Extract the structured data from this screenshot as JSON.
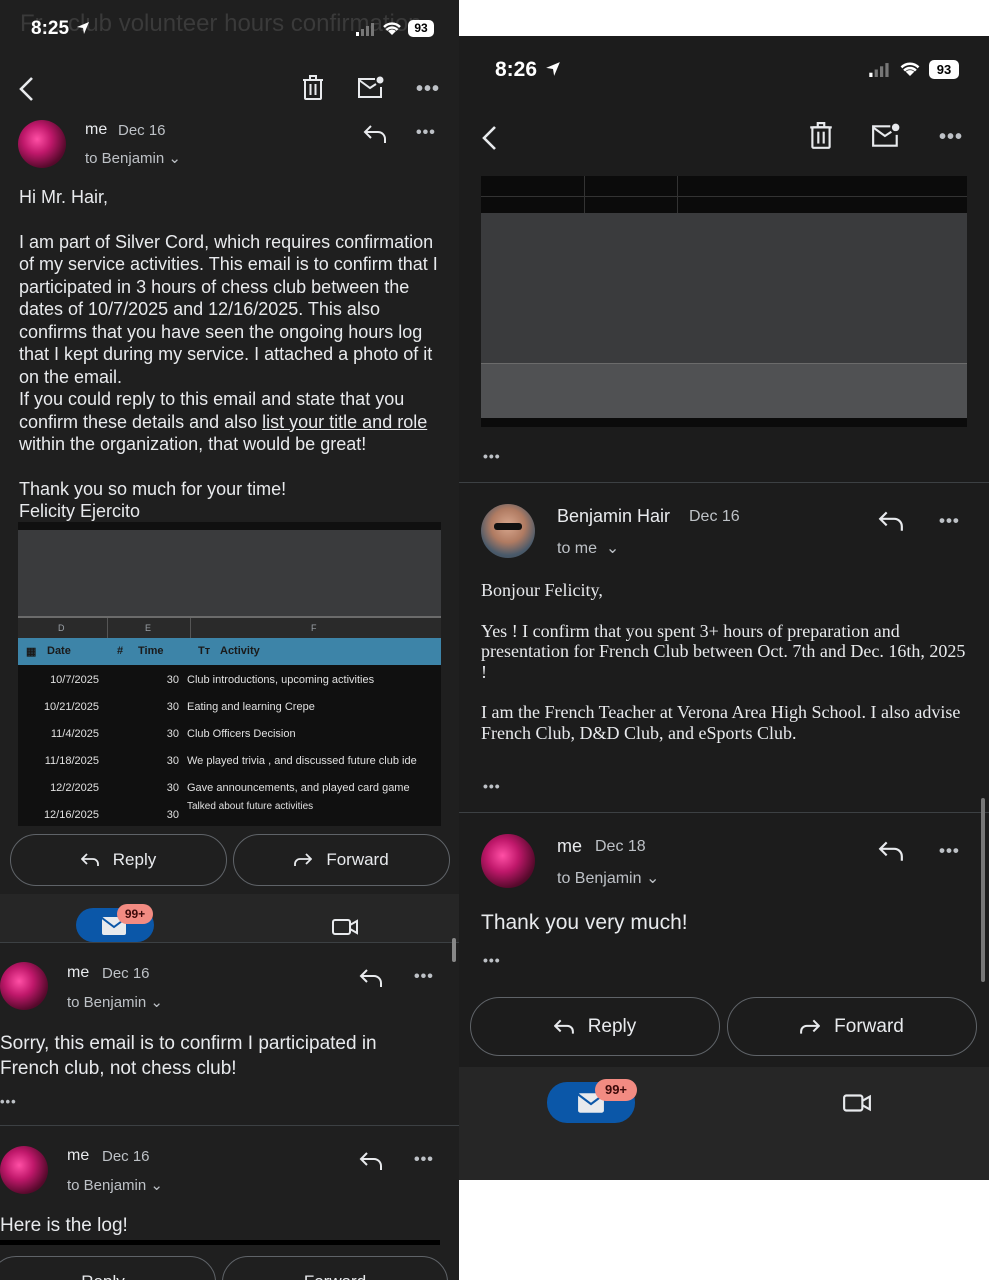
{
  "left": {
    "status": {
      "time": "8:25",
      "battery": "93"
    },
    "header_title_ghost": "Fr... club volunteer hours confirmation",
    "msg1": {
      "sender": "me",
      "date": "Dec 16",
      "to": "to Benjamin",
      "greeting": "Hi Mr. Hair,",
      "p1": "I am part of Silver Cord, which requires confirmation of my service activities. This email is to confirm that I participated in 3 hours of chess club between the dates of 10/7/2025 and 12/16/2025.  This also confirms that you have seen the ongoing hours log that I kept during my service. I attached a photo of it on the email.",
      "p2_pre": "If you could reply to this email and state that you confirm these details and also ",
      "p2_link": "list your title and role ",
      "p2_post": "within the organization, that would be great!",
      "thanks": "Thank you so much for your time!",
      "signature": "Felicity Ejercito"
    },
    "log": {
      "col_letters": [
        "D",
        "E",
        "F"
      ],
      "headers": [
        "Date",
        "Time",
        "Activity"
      ],
      "rows": [
        {
          "date": "10/7/2025",
          "time": "30",
          "activity": "Club introductions, upcoming activities"
        },
        {
          "date": "10/21/2025",
          "time": "30",
          "activity": "Eating and learning Crepe"
        },
        {
          "date": "11/4/2025",
          "time": "30",
          "activity": "Club Officers Decision"
        },
        {
          "date": "11/18/2025",
          "time": "30",
          "activity": "We played trivia , and discussed future club ide"
        },
        {
          "date": "12/2/2025",
          "time": "30",
          "activity": "Gave announcements, and played card game"
        },
        {
          "date": "12/16/2025",
          "time": "30",
          "activity": "Talked about future activities"
        }
      ]
    },
    "actions": {
      "reply": "Reply",
      "forward": "Forward"
    },
    "badge": "99+",
    "msg2": {
      "sender": "me",
      "date": "Dec 16",
      "to": "to Benjamin",
      "body": "Sorry, this email is to confirm I participated in French club, not chess club!"
    },
    "msg3": {
      "sender": "me",
      "date": "Dec 16",
      "to": "to Benjamin",
      "body": "Here is the log!"
    },
    "bottom_actions": {
      "reply": "Reply",
      "forward": "Forward"
    }
  },
  "right": {
    "status": {
      "time": "8:26",
      "battery": "93"
    },
    "msg1": {
      "sender": "Benjamin Hair",
      "date": "Dec 16",
      "to": "to me",
      "greeting": "Bonjour Felicity,",
      "p1": "Yes ! I confirm that you spent 3+ hours of preparation and presentation for French Club between Oct. 7th and Dec. 16th, 2025 !",
      "p2": "I am the French Teacher at Verona Area High School. I also advise French Club, D&D Club, and eSports Club."
    },
    "msg2": {
      "sender": "me",
      "date": "Dec 18",
      "to": "to Benjamin",
      "body": "Thank you very much!"
    },
    "actions": {
      "reply": "Reply",
      "forward": "Forward"
    },
    "badge": "99+"
  },
  "icons": [
    "back-arrow-icon",
    "trash-icon",
    "mark-unread-icon",
    "more-icon",
    "reply-icon",
    "forward-icon",
    "mail-icon",
    "video-icon",
    "location-arrow-icon",
    "signal-icon",
    "wifi-icon",
    "battery-icon"
  ],
  "colors": {
    "background": "#1f1f1f",
    "text": "#e8eaed",
    "secondary": "#bdc1c6",
    "accent_blue": "#0b57a8",
    "badge": "#f28b82",
    "sheet_header": "#3d84a8"
  }
}
